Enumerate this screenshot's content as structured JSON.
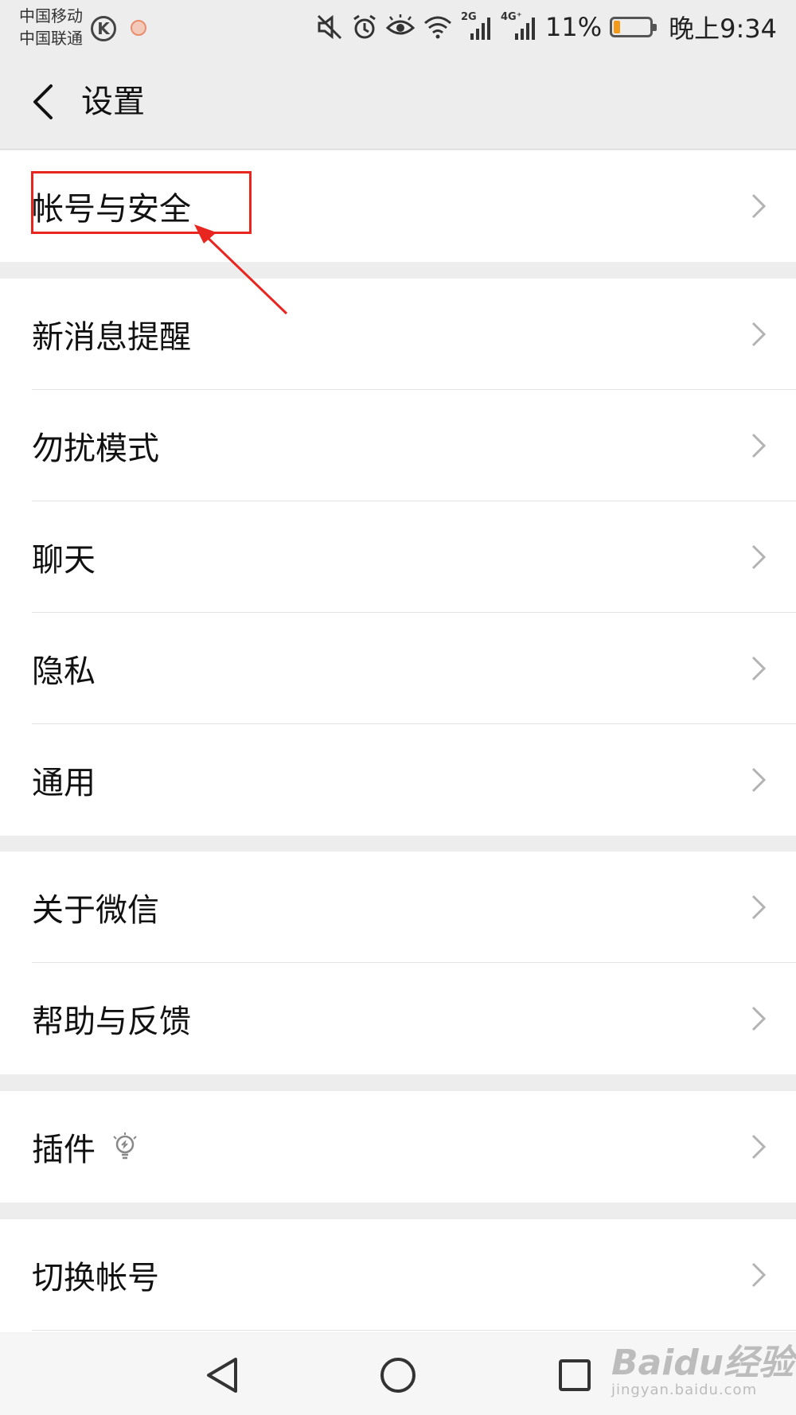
{
  "status_bar": {
    "carrier_1": "中国移动",
    "carrier_2": "中国联通",
    "k_badge": "K",
    "network_2g": "2G",
    "network_4g": "4G⁺",
    "battery_percent": "11%",
    "battery_level": 0.11,
    "battery_color": "#f39a1a",
    "time": "晚上9:34",
    "icons": [
      "small-app-icon",
      "mute-icon",
      "alarm-icon",
      "eye-comfort-icon",
      "wifi-icon",
      "signal-2g-icon",
      "signal-4g-icon",
      "battery-icon"
    ]
  },
  "header": {
    "back_icon": "chevron-left-icon",
    "title": "设置"
  },
  "groups": [
    {
      "items": [
        {
          "label": "帐号与安全"
        }
      ]
    },
    {
      "items": [
        {
          "label": "新消息提醒"
        },
        {
          "label": "勿扰模式"
        },
        {
          "label": "聊天"
        },
        {
          "label": "隐私"
        },
        {
          "label": "通用"
        }
      ]
    },
    {
      "items": [
        {
          "label": "关于微信"
        },
        {
          "label": "帮助与反馈"
        }
      ]
    },
    {
      "items": [
        {
          "label": "插件",
          "icon": "lightbulb-icon"
        }
      ]
    },
    {
      "items": [
        {
          "label": "切换帐号"
        }
      ]
    }
  ],
  "annotation": {
    "highlight_color": "#e8261f",
    "target": "帐号与安全"
  },
  "nav_bar": {
    "icons": [
      "nav-back-icon",
      "nav-home-icon",
      "nav-recent-icon"
    ]
  },
  "watermark": {
    "brand": "Baidu经验",
    "domain": "jingyan.baidu.com"
  }
}
